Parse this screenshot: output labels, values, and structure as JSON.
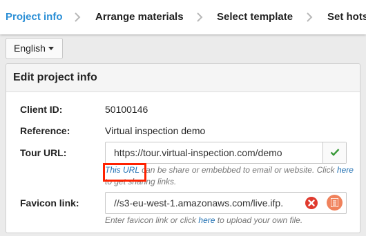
{
  "wizard": {
    "steps": [
      {
        "label": "Project info",
        "active": true
      },
      {
        "label": "Arrange materials",
        "active": false
      },
      {
        "label": "Select template",
        "active": false
      },
      {
        "label": "Set hots",
        "active": false
      }
    ]
  },
  "language": {
    "selected": "English"
  },
  "panel": {
    "title": "Edit project info"
  },
  "form": {
    "client_id": {
      "label": "Client ID:",
      "value": "50100146"
    },
    "reference": {
      "label": "Reference:",
      "value": "Virtual inspection demo"
    },
    "tour_url": {
      "label": "Tour URL:",
      "value": "https://tour.virtual-inspection.com/demo",
      "help_link": "This URL",
      "help_middle": " can be share or embebbed to email or website. Click ",
      "help_link2": "here",
      "help_end": "to get sharing links."
    },
    "favicon": {
      "label": "Favicon link:",
      "value": "//s3-eu-west-1.amazonaws.com/live.ifp.",
      "help_start": "Enter favicon link or click ",
      "help_link": "here",
      "help_end": " to upload your own file."
    }
  },
  "icons": {
    "valid": "check-icon",
    "clear": "clear-icon",
    "upload": "upload-icon"
  },
  "colors": {
    "accent": "#2b8fd6",
    "valid": "#3a9a3a",
    "clear": "#e03a2e",
    "upload": "#f0825c",
    "highlight": "#ff2200"
  }
}
